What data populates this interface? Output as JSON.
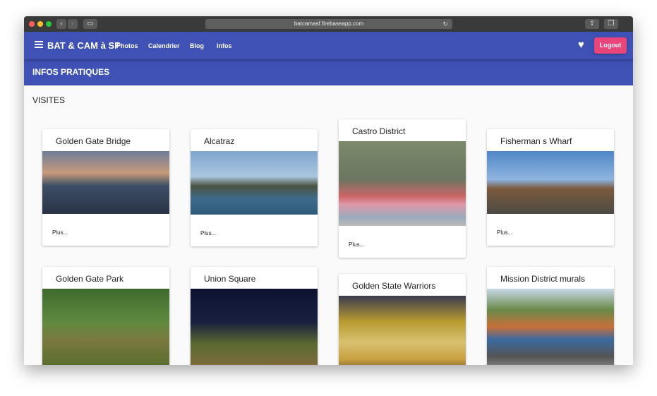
{
  "browser": {
    "url": "batcamasf.firebaseapp.com"
  },
  "nav": {
    "brand": "BAT & CAM à SF",
    "links": [
      "Photos",
      "Calendrier",
      "Blog",
      "Infos"
    ],
    "logout": "Logout"
  },
  "subheader": {
    "title": "INFOS PRATIQUES"
  },
  "section": {
    "title": "VISITES"
  },
  "cards": [
    {
      "title": "Golden Gate Bridge",
      "more": "Plus..."
    },
    {
      "title": "Alcatraz",
      "more": "Plus..."
    },
    {
      "title": "Castro District",
      "more": "Plus..."
    },
    {
      "title": "Fisherman s Wharf",
      "more": "Plus..."
    },
    {
      "title": "Golden Gate Park"
    },
    {
      "title": "Union Square"
    },
    {
      "title": "Golden State Warriors"
    },
    {
      "title": "Mission District murals"
    }
  ],
  "colors": {
    "primary": "#3f51b5",
    "accent": "#e8457a"
  }
}
